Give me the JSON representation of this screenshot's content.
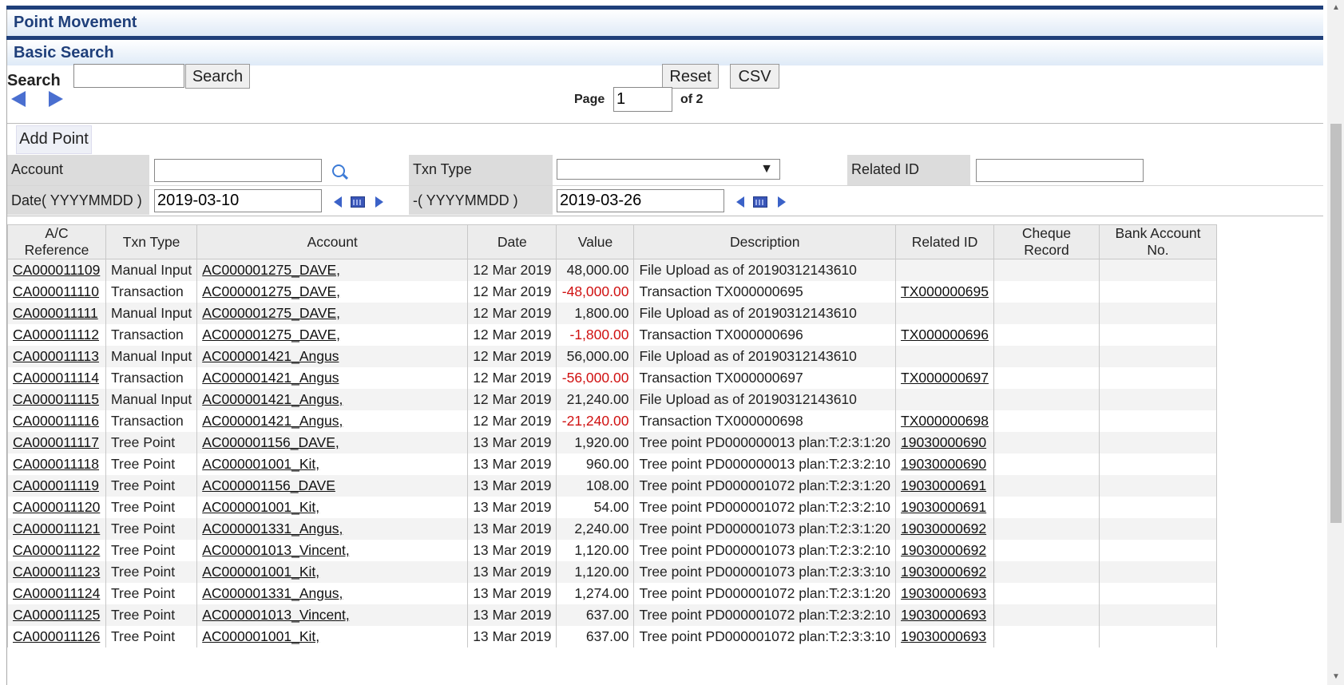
{
  "header": {
    "title": "Point Movement",
    "section": "Basic Search"
  },
  "search": {
    "label": "Search",
    "search_button": "Search",
    "reset_button": "Reset",
    "csv_button": "CSV",
    "page_label": "Page",
    "page_value": "1",
    "page_total": "of 2"
  },
  "actions": {
    "add_point": "Add Point"
  },
  "filters": {
    "account_label": "Account",
    "txn_type_label": "Txn Type",
    "related_id_label": "Related ID",
    "date_label": "Date( YYYYMMDD )",
    "date_from": "2019-03-10",
    "date_to_label": "-( YYYYMMDD )",
    "date_to": "2019-03-26",
    "txn_type_arrow": "▼"
  },
  "table": {
    "columns": [
      "A/C Reference",
      "Txn Type",
      "Account",
      "Date",
      "Value",
      "Description",
      "Related ID",
      "Cheque Record",
      "Bank Account No."
    ],
    "rows": [
      {
        "ref": "CA000011109",
        "type": "Manual Input",
        "account": "AC000001275_DAVE,",
        "date": "12 Mar 2019",
        "value": "48,000.00",
        "neg": false,
        "desc": "File Upload as of 20190312143610",
        "rid": ""
      },
      {
        "ref": "CA000011110",
        "type": "Transaction",
        "account": "AC000001275_DAVE,",
        "date": "12 Mar 2019",
        "value": "-48,000.00",
        "neg": true,
        "desc": "Transaction TX000000695",
        "rid": "TX000000695"
      },
      {
        "ref": "CA000011111",
        "type": "Manual Input",
        "account": "AC000001275_DAVE,",
        "date": "12 Mar 2019",
        "value": "1,800.00",
        "neg": false,
        "desc": "File Upload as of 20190312143610",
        "rid": ""
      },
      {
        "ref": "CA000011112",
        "type": "Transaction",
        "account": "AC000001275_DAVE,",
        "date": "12 Mar 2019",
        "value": "-1,800.00",
        "neg": true,
        "desc": "Transaction TX000000696",
        "rid": "TX000000696"
      },
      {
        "ref": "CA000011113",
        "type": "Manual Input",
        "account": "AC000001421_Angus",
        "date": "12 Mar 2019",
        "value": "56,000.00",
        "neg": false,
        "desc": "File Upload as of 20190312143610",
        "rid": ""
      },
      {
        "ref": "CA000011114",
        "type": "Transaction",
        "account": "AC000001421_Angus",
        "date": "12 Mar 2019",
        "value": "-56,000.00",
        "neg": true,
        "desc": "Transaction TX000000697",
        "rid": "TX000000697"
      },
      {
        "ref": "CA000011115",
        "type": "Manual Input",
        "account": "AC000001421_Angus,",
        "date": "12 Mar 2019",
        "value": "21,240.00",
        "neg": false,
        "desc": "File Upload as of 20190312143610",
        "rid": ""
      },
      {
        "ref": "CA000011116",
        "type": "Transaction",
        "account": "AC000001421_Angus,",
        "date": "12 Mar 2019",
        "value": "-21,240.00",
        "neg": true,
        "desc": "Transaction TX000000698",
        "rid": "TX000000698"
      },
      {
        "ref": "CA000011117",
        "type": "Tree Point",
        "account": "AC000001156_DAVE,",
        "date": "13 Mar 2019",
        "value": "1,920.00",
        "neg": false,
        "desc": "Tree point PD000000013 plan:T:2:3:1:20",
        "rid": "19030000690"
      },
      {
        "ref": "CA000011118",
        "type": "Tree Point",
        "account": "AC000001001_Kit,",
        "date": "13 Mar 2019",
        "value": "960.00",
        "neg": false,
        "desc": "Tree point PD000000013 plan:T:2:3:2:10",
        "rid": "19030000690"
      },
      {
        "ref": "CA000011119",
        "type": "Tree Point",
        "account": "AC000001156_DAVE",
        "date": "13 Mar 2019",
        "value": "108.00",
        "neg": false,
        "desc": "Tree point PD000001072 plan:T:2:3:1:20",
        "rid": "19030000691"
      },
      {
        "ref": "CA000011120",
        "type": "Tree Point",
        "account": "AC000001001_Kit,",
        "date": "13 Mar 2019",
        "value": "54.00",
        "neg": false,
        "desc": "Tree point PD000001072 plan:T:2:3:2:10",
        "rid": "19030000691"
      },
      {
        "ref": "CA000011121",
        "type": "Tree Point",
        "account": "AC000001331_Angus,",
        "date": "13 Mar 2019",
        "value": "2,240.00",
        "neg": false,
        "desc": "Tree point PD000001073 plan:T:2:3:1:20",
        "rid": "19030000692"
      },
      {
        "ref": "CA000011122",
        "type": "Tree Point",
        "account": "AC000001013_Vincent,",
        "date": "13 Mar 2019",
        "value": "1,120.00",
        "neg": false,
        "desc": "Tree point PD000001073 plan:T:2:3:2:10",
        "rid": "19030000692"
      },
      {
        "ref": "CA000011123",
        "type": "Tree Point",
        "account": "AC000001001_Kit,",
        "date": "13 Mar 2019",
        "value": "1,120.00",
        "neg": false,
        "desc": "Tree point PD000001073 plan:T:2:3:3:10",
        "rid": "19030000692"
      },
      {
        "ref": "CA000011124",
        "type": "Tree Point",
        "account": "AC000001331_Angus,",
        "date": "13 Mar 2019",
        "value": "1,274.00",
        "neg": false,
        "desc": "Tree point PD000001072 plan:T:2:3:1:20",
        "rid": "19030000693"
      },
      {
        "ref": "CA000011125",
        "type": "Tree Point",
        "account": "AC000001013_Vincent,",
        "date": "13 Mar 2019",
        "value": "637.00",
        "neg": false,
        "desc": "Tree point PD000001072 plan:T:2:3:2:10",
        "rid": "19030000693"
      },
      {
        "ref": "CA000011126",
        "type": "Tree Point",
        "account": "AC000001001_Kit,",
        "date": "13 Mar 2019",
        "value": "637.00",
        "neg": false,
        "desc": "Tree point PD000001072 plan:T:2:3:3:10",
        "rid": "19030000693"
      }
    ]
  },
  "colors": {
    "header_navy": "#1f3f7a",
    "negative": "#d01010",
    "nav_arrow": "#4a6fd0"
  }
}
